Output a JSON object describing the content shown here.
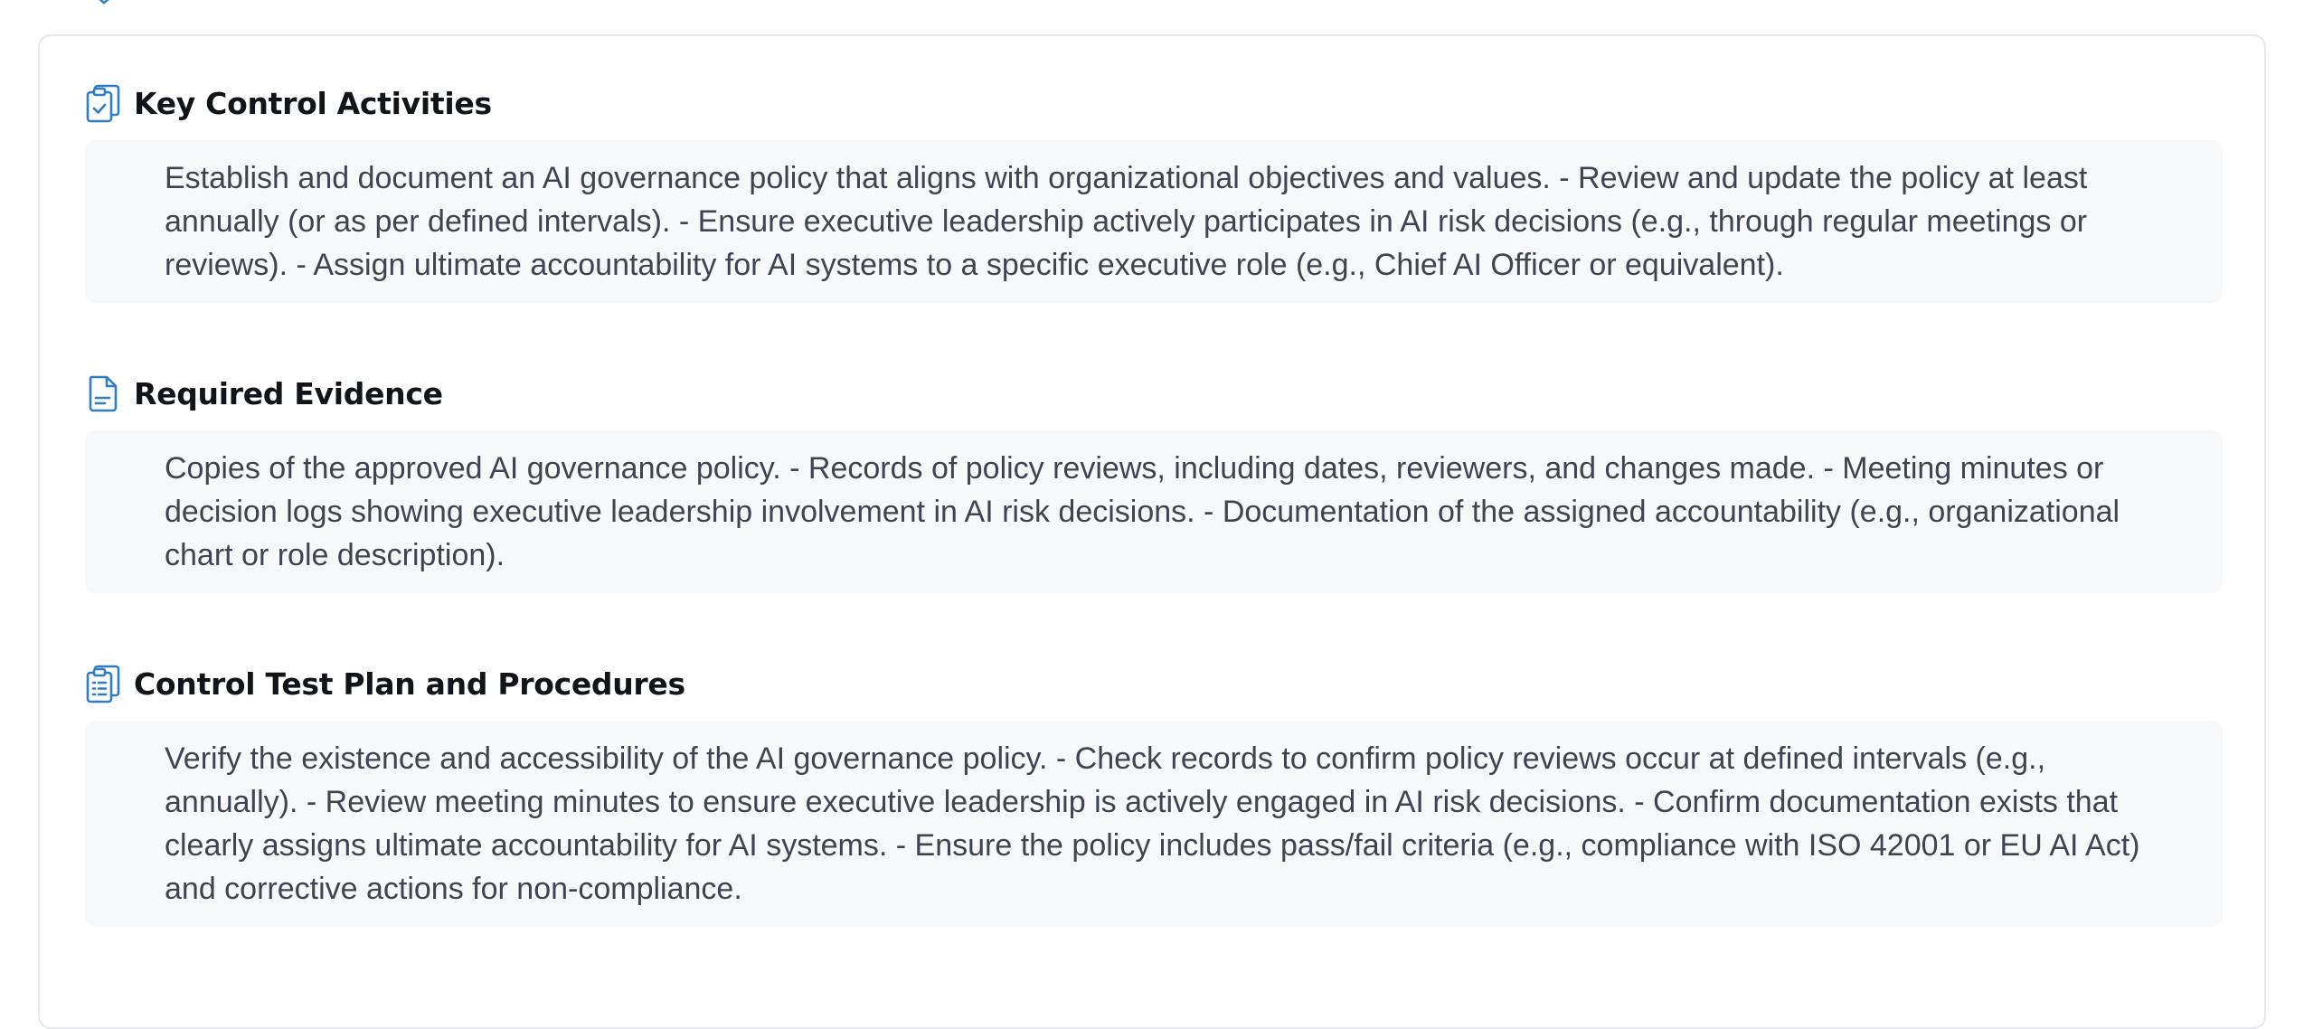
{
  "colors": {
    "accent": "#2f7cc7",
    "heading": "#111418",
    "body_text": "#3e4550",
    "panel_bg": "#f7f8fa",
    "card_border": "#e6e8eb"
  },
  "sections": [
    {
      "icon": "clipboard-check-icon",
      "title": "Key Control Activities",
      "body": "Establish and document an AI governance policy that aligns with organizational objectives and values. - Review and update the policy at least annually (or as per defined intervals). - Ensure executive leadership actively participates in AI risk decisions (e.g., through regular meetings or reviews). - Assign ultimate accountability for AI systems to a specific executive role (e.g., Chief AI Officer or equivalent)."
    },
    {
      "icon": "document-icon",
      "title": "Required Evidence",
      "body": "Copies of the approved AI governance policy. - Records of policy reviews, including dates, reviewers, and changes made. - Meeting minutes or decision logs showing executive leadership involvement in AI risk decisions. - Documentation of the assigned accountability (e.g., organizational chart or role description)."
    },
    {
      "icon": "clipboard-list-icon",
      "title": "Control Test Plan and Procedures",
      "body": "Verify the existence and accessibility of the AI governance policy. - Check records to confirm policy reviews occur at defined intervals (e.g., annually). - Review meeting minutes to ensure executive leadership is actively engaged in AI risk decisions. - Confirm documentation exists that clearly assigns ultimate accountability for AI systems. - Ensure the policy includes pass/fail criteria (e.g., compliance with ISO 42001 or EU AI Act) and corrective actions for non-compliance."
    }
  ]
}
